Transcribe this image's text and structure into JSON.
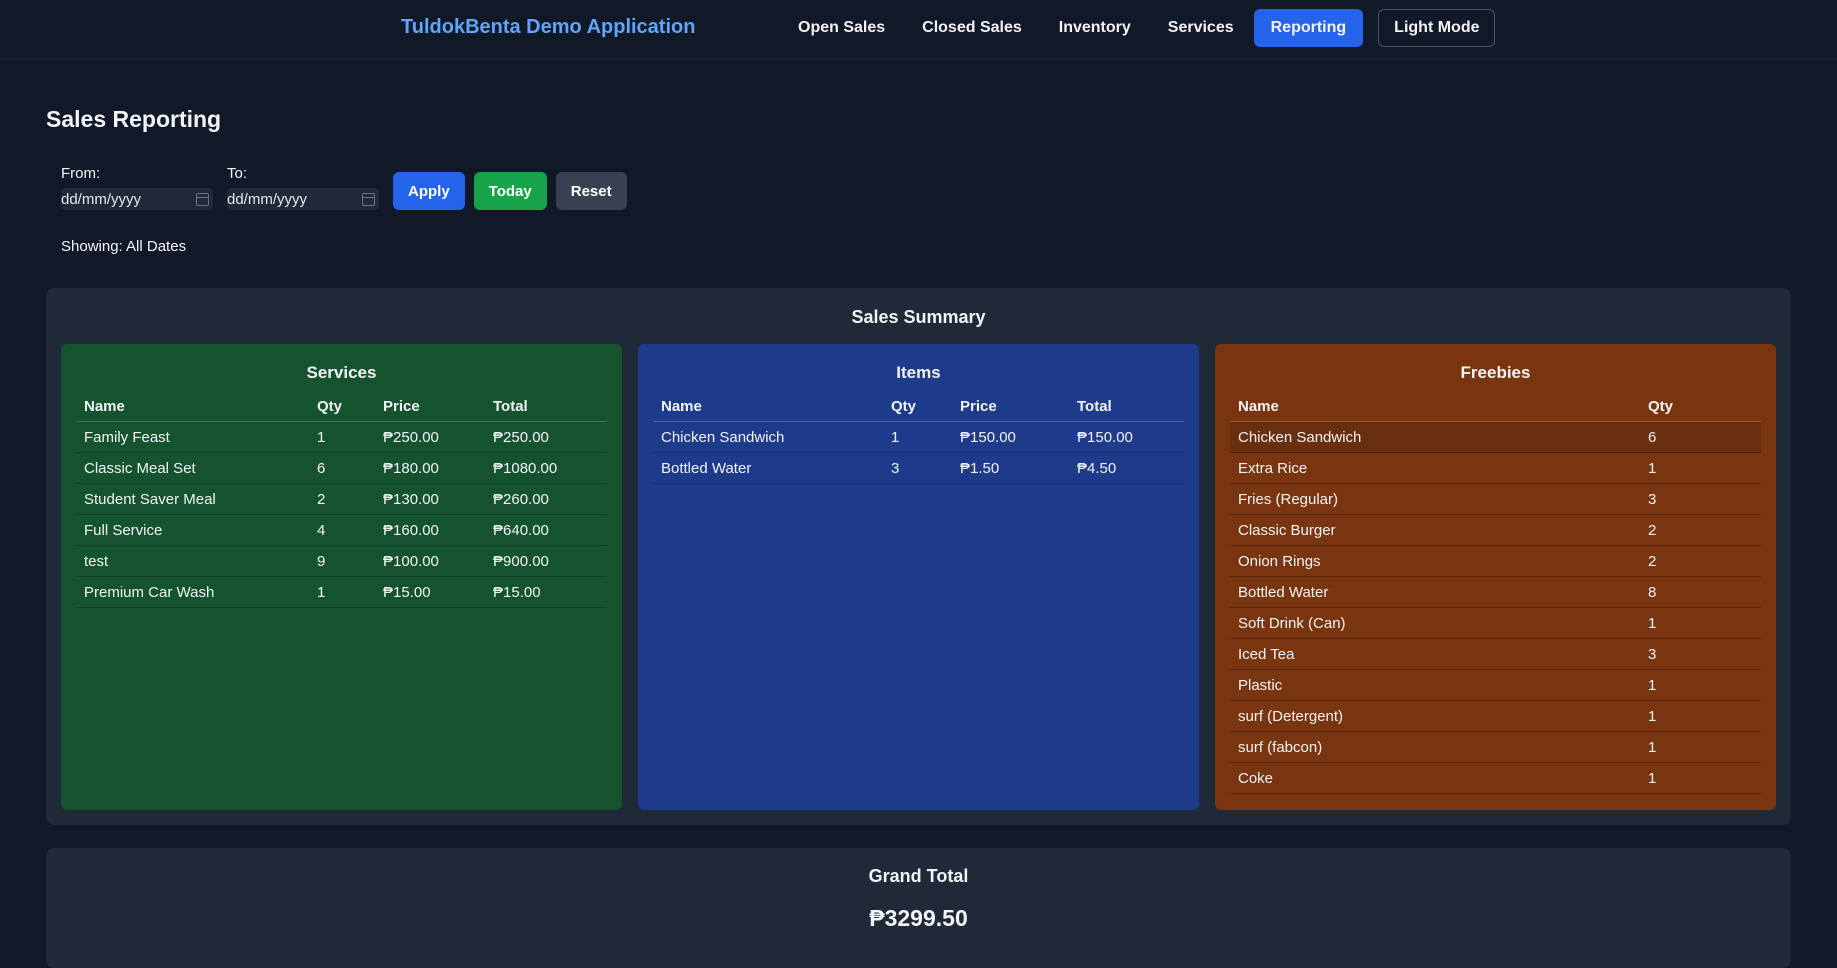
{
  "nav": {
    "brand": "TuldokBenta Demo Application",
    "links": [
      "Open Sales",
      "Closed Sales",
      "Inventory",
      "Services",
      "Reporting"
    ],
    "active": "Reporting",
    "theme_toggle": "Light Mode"
  },
  "page": {
    "title": "Sales Reporting",
    "from_label": "From:",
    "to_label": "To:",
    "from_placeholder": "dd/mm/yyyy",
    "to_placeholder": "dd/mm/yyyy",
    "apply": "Apply",
    "today": "Today",
    "reset": "Reset",
    "showing": "Showing: All Dates"
  },
  "summary": {
    "title": "Sales Summary",
    "services": {
      "title": "Services",
      "headers": [
        "Name",
        "Qty",
        "Price",
        "Total"
      ],
      "rows": [
        [
          "Family Feast",
          "1",
          "₱250.00",
          "₱250.00"
        ],
        [
          "Classic Meal Set",
          "6",
          "₱180.00",
          "₱1080.00"
        ],
        [
          "Student Saver Meal",
          "2",
          "₱130.00",
          "₱260.00"
        ],
        [
          "Full Service",
          "4",
          "₱160.00",
          "₱640.00"
        ],
        [
          "test",
          "9",
          "₱100.00",
          "₱900.00"
        ],
        [
          "Premium Car Wash",
          "1",
          "₱15.00",
          "₱15.00"
        ]
      ]
    },
    "items": {
      "title": "Items",
      "headers": [
        "Name",
        "Qty",
        "Price",
        "Total"
      ],
      "rows": [
        [
          "Chicken Sandwich",
          "1",
          "₱150.00",
          "₱150.00"
        ],
        [
          "Bottled Water",
          "3",
          "₱1.50",
          "₱4.50"
        ]
      ]
    },
    "freebies": {
      "title": "Freebies",
      "headers": [
        "Name",
        "Qty"
      ],
      "rows": [
        [
          "Chicken Sandwich",
          "6"
        ],
        [
          "Extra Rice",
          "1"
        ],
        [
          "Fries (Regular)",
          "3"
        ],
        [
          "Classic Burger",
          "2"
        ],
        [
          "Onion Rings",
          "2"
        ],
        [
          "Bottled Water",
          "8"
        ],
        [
          "Soft Drink (Can)",
          "1"
        ],
        [
          "Iced Tea",
          "3"
        ],
        [
          "Plastic",
          "1"
        ],
        [
          "surf (Detergent)",
          "1"
        ],
        [
          "surf (fabcon)",
          "1"
        ],
        [
          "Coke",
          "1"
        ]
      ]
    }
  },
  "grand_total": {
    "title": "Grand Total",
    "value": "₱3299.50"
  }
}
